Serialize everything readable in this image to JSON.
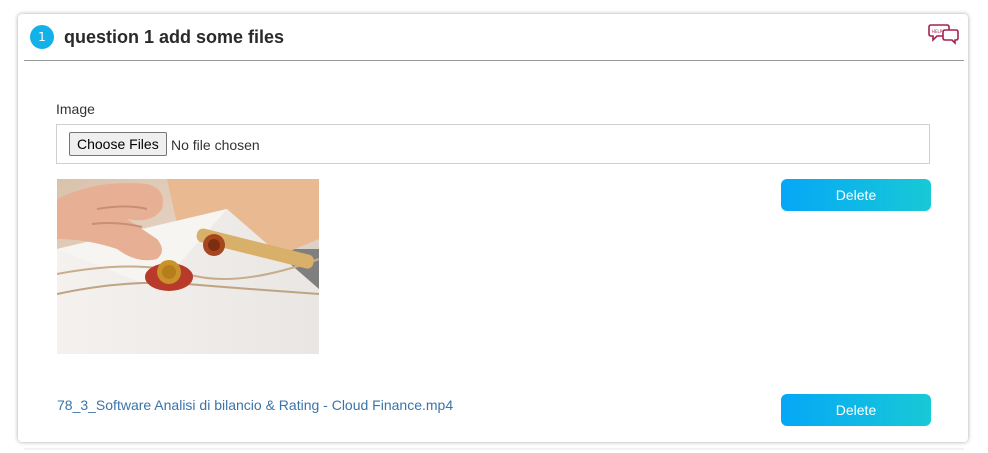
{
  "question": {
    "number": "1",
    "title": "question 1 add some files",
    "help_icon_text": "HELP"
  },
  "upload": {
    "label": "Image",
    "choose_button": "Choose Files",
    "status": "No file chosen"
  },
  "files": [
    {
      "type": "image",
      "delete_label": "Delete"
    },
    {
      "type": "video",
      "name": "78_3_Software Analisi di bilancio & Rating - Cloud Finance.mp4",
      "delete_label": "Delete"
    }
  ],
  "colors": {
    "accent": "#14b0e8",
    "button_gradient_start": "#05a7f6",
    "button_gradient_end": "#18c9d6",
    "link": "#3b74a8",
    "help_icon": "#a8204f"
  },
  "icons": {
    "help": "help-speech-bubbles-icon"
  }
}
